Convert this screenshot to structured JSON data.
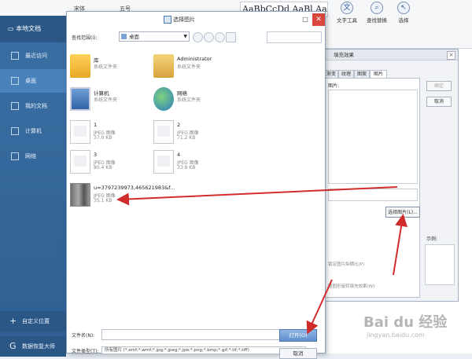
{
  "ribbon": {
    "font_name": "宋体",
    "font_size": "五号",
    "styles_preview": "AaBbCcDd AaBl AaBbC",
    "btn_text_tools": "文字工具",
    "btn_find": "查找替换",
    "btn_select": "选择"
  },
  "nav": {
    "brand": "本地文档",
    "items": [
      {
        "label": "最近访问"
      },
      {
        "label": "桌面"
      },
      {
        "label": "我的文档"
      },
      {
        "label": "计算机"
      },
      {
        "label": "网络"
      }
    ],
    "add_location": "自定义位置",
    "recover": "数据恢复大师"
  },
  "dialog": {
    "title": "选择图片",
    "look_in_label": "查找范围(I):",
    "look_in_value": "桌面",
    "files": [
      {
        "name": "库",
        "type": "系统文件夹",
        "size": ""
      },
      {
        "name": "Administrator",
        "type": "系统文件夹",
        "size": ""
      },
      {
        "name": "计算机",
        "type": "系统文件夹",
        "size": ""
      },
      {
        "name": "网络",
        "type": "系统文件夹",
        "size": ""
      },
      {
        "name": "1",
        "type": "JPEG 图像",
        "size": "37.0 KB"
      },
      {
        "name": "2",
        "type": "JPEG 图像",
        "size": "71.2 KB"
      },
      {
        "name": "3",
        "type": "JPEG 图像",
        "size": "80.4 KB"
      },
      {
        "name": "4",
        "type": "JPEG 图像",
        "size": "33.9 KB"
      },
      {
        "name": "u=3797239973,465621983&f...",
        "type": "JPEG 图像",
        "size": "35.1 KB"
      }
    ],
    "filename_label": "文件名(N):",
    "filename_value": "",
    "filetype_label": "文件类型(T):",
    "filetype_value": "所有图片 (*.emf;*.wmf;*.jpg;*.jpeg;*.jpe;*.png;*.bmp;*.gif;*.tif;*.tiff)",
    "open_button": "打开(O)",
    "cancel_button": "取消"
  },
  "border_dialog": {
    "title": "填充效果",
    "tabs": [
      "渐变",
      "纹理",
      "图案",
      "图片"
    ],
    "picture_label": "图片:",
    "ok_button": "确定",
    "cancel_button": "取消",
    "choose_picture_button": "选择图片(L)...",
    "sample_label": "示例:",
    "lock_aspect": "锁定图片纵横比(P)",
    "rotate_with_shape": "随图形旋转填充效果(W)"
  },
  "watermark": {
    "brand": "Bai du 经验",
    "url": "jingyan.baidu.com"
  },
  "colors": {
    "nav_bg": "#3a6fa3",
    "arrow": "#d12c2c",
    "close": "#d9463e"
  }
}
